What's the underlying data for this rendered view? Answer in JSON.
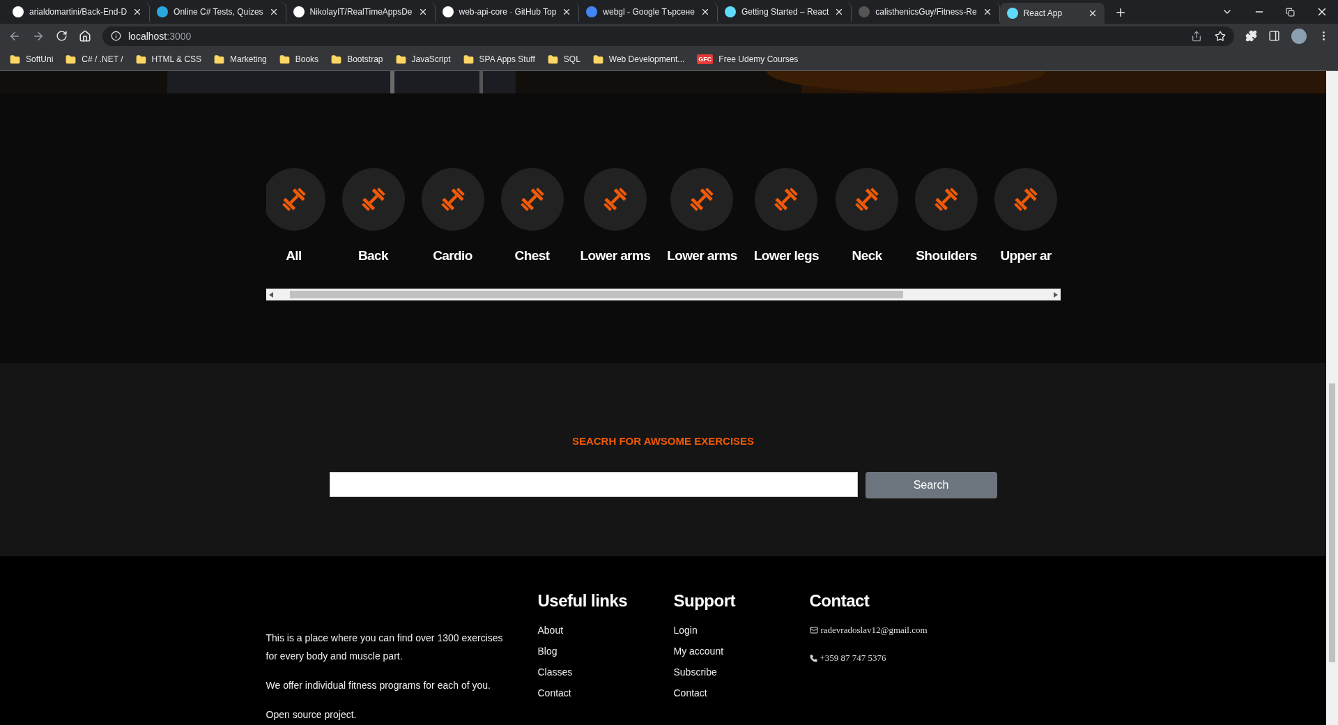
{
  "browser": {
    "tabs": [
      {
        "title": "arialdomartini/Back-End-D",
        "kind": "github",
        "selected": false
      },
      {
        "title": "Online C# Tests, Quizes",
        "kind": "quiz",
        "selected": false
      },
      {
        "title": "NikolayIT/RealTimeAppsDe",
        "kind": "github",
        "selected": false
      },
      {
        "title": "web-api-core · GitHub Top",
        "kind": "github",
        "selected": false
      },
      {
        "title": "webgl - Google Търсене",
        "kind": "google",
        "selected": false
      },
      {
        "title": "Getting Started – React",
        "kind": "react",
        "selected": false
      },
      {
        "title": "calisthenicsGuy/Fitness-Re",
        "kind": "faded",
        "selected": false
      },
      {
        "title": "React App",
        "kind": "react",
        "selected": true
      }
    ],
    "address": {
      "host": "localhost",
      "port": ":3000"
    },
    "bookmarks": [
      {
        "label": "SoftUni",
        "kind": "folder"
      },
      {
        "label": "C# / .NET /",
        "kind": "folder"
      },
      {
        "label": "HTML & CSS",
        "kind": "folder"
      },
      {
        "label": "Marketing",
        "kind": "folder"
      },
      {
        "label": "Books",
        "kind": "folder"
      },
      {
        "label": "Bootstrap",
        "kind": "folder"
      },
      {
        "label": "JavaScript",
        "kind": "folder"
      },
      {
        "label": "SPA Apps Stuff",
        "kind": "folder"
      },
      {
        "label": "SQL",
        "kind": "folder"
      },
      {
        "label": "Web Development...",
        "kind": "folder"
      },
      {
        "label": "Free Udemy Courses",
        "kind": "site",
        "badge": "GFC"
      }
    ]
  },
  "categories": [
    {
      "label": "All"
    },
    {
      "label": "Back"
    },
    {
      "label": "Cardio"
    },
    {
      "label": "Chest"
    },
    {
      "label": "Lower arms"
    },
    {
      "label": "Lower arms"
    },
    {
      "label": "Lower legs"
    },
    {
      "label": "Neck"
    },
    {
      "label": "Shoulders"
    },
    {
      "label": "Upper ar"
    }
  ],
  "search": {
    "heading": "SEACRH FOR AWSOME EXERCISES",
    "button": "Search"
  },
  "footer": {
    "about": [
      "This is a place where you can find over 1300 exercises for every body and muscle part.",
      "We offer individual fitness programs for each of you.",
      "Open source project."
    ],
    "columns": [
      {
        "heading": "Useful links",
        "links": [
          "About",
          "Blog",
          "Classes",
          "Contact"
        ]
      },
      {
        "heading": "Support",
        "links": [
          "Login",
          "My account",
          "Subscribe",
          "Contact"
        ]
      }
    ],
    "contact": {
      "heading": "Contact",
      "email": "radevradoslav12@gmail.com",
      "phone": "+359 87 747 5376"
    }
  }
}
